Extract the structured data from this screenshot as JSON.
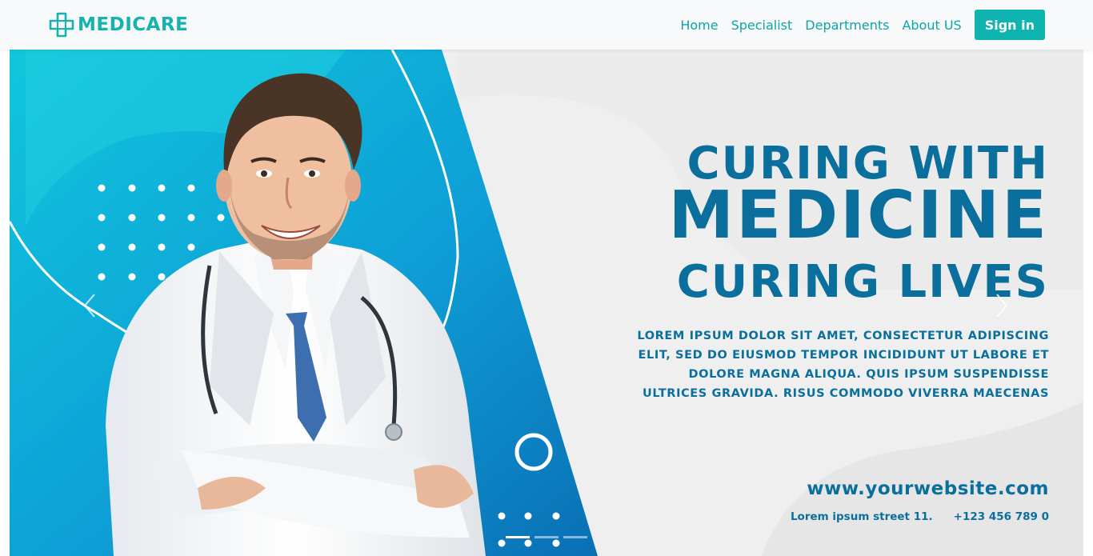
{
  "brand": {
    "name": "MEDICARE",
    "icon": "medical-cross-icon"
  },
  "nav": {
    "links": [
      "Home",
      "Specialist",
      "Departments",
      "About US"
    ],
    "signin": "Sign in"
  },
  "hero": {
    "headline_1": "CURING WITH",
    "headline_2": "MEDICINE",
    "headline_3": "CURING LIVES",
    "desc_1": "LOREM IPSUM DOLOR SIT AMET, CONSECTETUR ADIPISCING",
    "desc_2": "ELIT, SED DO EIUSMOD TEMPOR INCIDIDUNT UT LABORE ET",
    "desc_3": "DOLORE MAGNA ALIQUA. QUIS IPSUM SUSPENDISSE",
    "desc_4": "ULTRICES GRAVIDA. RISUS COMMODO VIVERRA MAECENAS",
    "website": "www.yourwebsite.com",
    "address": "Lorem ipsum street 11.",
    "phone": "+123 456 789 0"
  },
  "carousel": {
    "slides": 3,
    "active": 1,
    "prev_icon": "chevron-left-icon",
    "next_icon": "chevron-right-icon"
  },
  "colors": {
    "brand": "#14b3ad",
    "accent": "#0fb3b0",
    "headline": "#0a6f9c",
    "blue": "#0b8fd0"
  }
}
